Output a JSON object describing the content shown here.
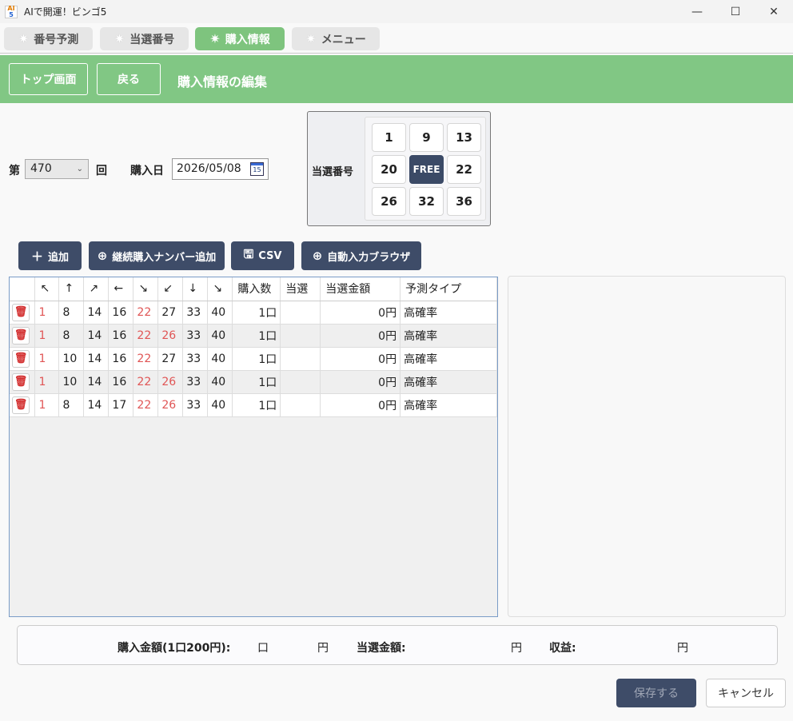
{
  "window": {
    "title": "AIで開運！ビンゴ5",
    "logo_top": "AI",
    "logo_bottom": "5",
    "minimize": "—",
    "maximize": "☐",
    "close": "✕"
  },
  "tabs": [
    {
      "label": "番号予測",
      "active": false
    },
    {
      "label": "当選番号",
      "active": false
    },
    {
      "label": "購入情報",
      "active": true
    },
    {
      "label": "メニュー",
      "active": false
    }
  ],
  "header": {
    "top_button": "トップ画面",
    "back_button": "戻る",
    "title": "購入情報の編集"
  },
  "form": {
    "round_prefix": "第",
    "round_value": "470",
    "round_suffix": "回",
    "date_label": "購入日",
    "date_value": "2026/05/08",
    "calendar_icon_text": "15"
  },
  "winning": {
    "label": "当選番号",
    "numbers": [
      "1",
      "9",
      "13",
      "20",
      "FREE",
      "22",
      "26",
      "32",
      "36"
    ]
  },
  "actions": {
    "add": "追加",
    "add_continuous": "継続購入ナンバー追加",
    "csv": "CSV",
    "auto_input": "自動入力ブラウザ"
  },
  "table": {
    "headers": [
      "",
      "↖",
      "↑",
      "↗",
      "←",
      "↘",
      "↙",
      "↓",
      "↘",
      "購入数",
      "当選",
      "当選金額",
      "予測タイプ"
    ],
    "rows": [
      {
        "n": [
          "1",
          "8",
          "14",
          "16",
          "22",
          "27",
          "33",
          "40"
        ],
        "qty": "1口",
        "win": "",
        "amount": "0円",
        "type": "高確率"
      },
      {
        "n": [
          "1",
          "8",
          "14",
          "16",
          "22",
          "26",
          "33",
          "40"
        ],
        "qty": "1口",
        "win": "",
        "amount": "0円",
        "type": "高確率"
      },
      {
        "n": [
          "1",
          "10",
          "14",
          "16",
          "22",
          "27",
          "33",
          "40"
        ],
        "qty": "1口",
        "win": "",
        "amount": "0円",
        "type": "高確率"
      },
      {
        "n": [
          "1",
          "10",
          "14",
          "16",
          "22",
          "26",
          "33",
          "40"
        ],
        "qty": "1口",
        "win": "",
        "amount": "0円",
        "type": "高確率"
      },
      {
        "n": [
          "1",
          "8",
          "14",
          "17",
          "22",
          "26",
          "33",
          "40"
        ],
        "qty": "1口",
        "win": "",
        "amount": "0円",
        "type": "高確率"
      }
    ]
  },
  "summary": {
    "purchase_label": "購入金額(1口200円):",
    "unit_kuchi": "口",
    "unit_yen": "円",
    "win_label": "当選金額:",
    "profit_label": "収益:"
  },
  "footer": {
    "save": "保存する",
    "cancel": "キャンセル"
  },
  "colors": {
    "accent_green": "#81c784",
    "dark_button": "#3e4c68",
    "hit_number": "#e05555"
  }
}
